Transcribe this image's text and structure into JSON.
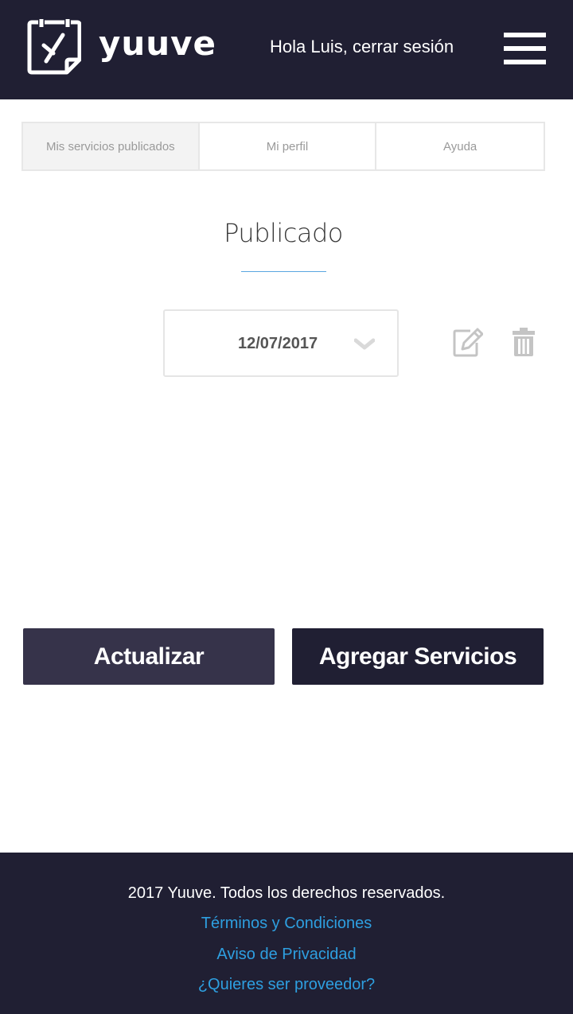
{
  "header": {
    "brand": "yuuve",
    "greeting": "Hola Luis, cerrar sesión",
    "colors": {
      "background": "#201f33",
      "text": "#ffffff"
    }
  },
  "tabs": [
    {
      "label": "Mis servicios publicados",
      "active": true
    },
    {
      "label": "Mi perfil",
      "active": false
    },
    {
      "label": "Ayuda",
      "active": false
    }
  ],
  "main": {
    "section_title": "Publicado",
    "date_select": {
      "value": "12/07/2017"
    },
    "actions": {
      "edit_icon": "edit-icon",
      "delete_icon": "trash-icon"
    },
    "accent_color": "#5aa6e0"
  },
  "buttons": {
    "update_label": "Actualizar",
    "add_label": "Agregar Servicios"
  },
  "footer": {
    "copyright": "2017 Yuuve.  Todos los derechos reservados.",
    "links": [
      "Términos y Condiciones",
      "Aviso de Privacidad",
      "¿Quieres ser proveedor?"
    ],
    "link_color": "#2e9fe0"
  }
}
